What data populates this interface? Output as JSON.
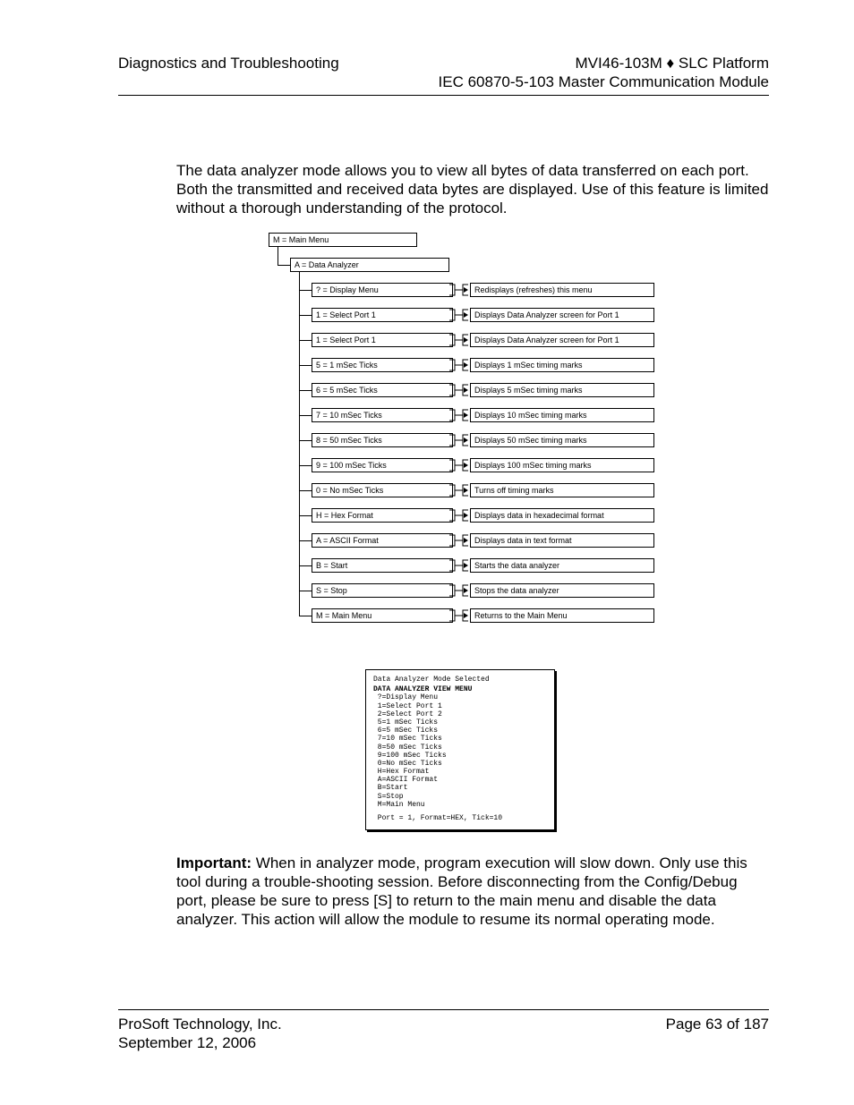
{
  "header": {
    "left": "Diagnostics and Troubleshooting",
    "right_line1": "MVI46-103M ♦ SLC Platform",
    "right_line2": "IEC 60870-5-103 Master Communication Module"
  },
  "intro": "The data analyzer mode allows you to view all bytes of data transferred on each port. Both the transmitted and received data bytes are displayed. Use of this feature is limited without a thorough understanding of the protocol.",
  "diagram": {
    "root": "M = Main Menu",
    "sub": "A = Data Analyzer",
    "rows": [
      {
        "cmd": "? = Display Menu",
        "desc": "Redisplays (refreshes) this menu"
      },
      {
        "cmd": "1 = Select Port 1",
        "desc": "Displays Data Analyzer screen for Port 1"
      },
      {
        "cmd": "1 = Select Port 1",
        "desc": "Displays Data Analyzer screen for Port 1"
      },
      {
        "cmd": "5 = 1 mSec Ticks",
        "desc": "Displays 1 mSec timing marks"
      },
      {
        "cmd": "6 = 5 mSec Ticks",
        "desc": "Displays 5 mSec timing marks"
      },
      {
        "cmd": "7 = 10 mSec Ticks",
        "desc": "Displays 10 mSec timing marks"
      },
      {
        "cmd": "8 = 50 mSec Ticks",
        "desc": "Displays 50 mSec timing marks"
      },
      {
        "cmd": "9 = 100 mSec Ticks",
        "desc": "Displays 100 mSec timing marks"
      },
      {
        "cmd": "0 = No mSec Ticks",
        "desc": "Turns off timing marks"
      },
      {
        "cmd": "H = Hex Format",
        "desc": "Displays data in hexadecimal format"
      },
      {
        "cmd": "A = ASCII Format",
        "desc": "Displays data in text format"
      },
      {
        "cmd": "B = Start",
        "desc": "Starts the data analyzer"
      },
      {
        "cmd": "S = Stop",
        "desc": "Stops the data analyzer"
      },
      {
        "cmd": "M = Main Menu",
        "desc": "Returns to the Main Menu"
      }
    ]
  },
  "terminal": {
    "title": "Data Analyzer Mode Selected",
    "heading": "DATA ANALYZER VIEW MENU",
    "lines": [
      "?=Display Menu",
      "1=Select Port 1",
      "2=Select Port 2",
      "5=1 mSec Ticks",
      "6=5 mSec Ticks",
      "7=10 mSec Ticks",
      "8=50 mSec Ticks",
      "9=100 mSec Ticks",
      "0=No mSec Ticks",
      "H=Hex Format",
      "A=ASCII Format",
      "B=Start",
      "S=Stop",
      "M=Main Menu"
    ],
    "footer": "Port = 1, Format=HEX, Tick=10"
  },
  "important": {
    "label": "Important:",
    "text1": " When in analyzer mode, program execution will slow down. Only use this tool during a trouble-shooting session. Before disconnecting from the Config/Debug port, please be sure to press ",
    "key": "[S]",
    "text2": " to return to the main menu and disable the data analyzer. This action will allow the module to resume its normal operating mode."
  },
  "footer": {
    "left_line1": "ProSoft Technology, Inc.",
    "left_line2": "September 12, 2006",
    "right": "Page 63 of 187"
  }
}
